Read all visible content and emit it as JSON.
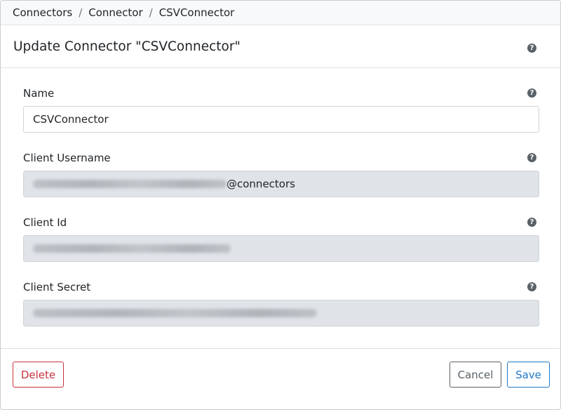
{
  "breadcrumb": {
    "items": [
      "Connectors",
      "Connector",
      "CSVConnector"
    ],
    "separator": "/"
  },
  "header": {
    "title": "Update Connector \"CSVConnector\"",
    "help_icon": "question-circle-icon"
  },
  "form": {
    "name": {
      "label": "Name",
      "value": "CSVConnector"
    },
    "client_username": {
      "label": "Client Username",
      "value_suffix": "@connectors",
      "value_redacted": true
    },
    "client_id": {
      "label": "Client Id",
      "value_redacted": true
    },
    "client_secret": {
      "label": "Client Secret",
      "value_redacted": true
    },
    "help_glyph": "?"
  },
  "footer": {
    "delete_label": "Delete",
    "cancel_label": "Cancel",
    "save_label": "Save"
  },
  "colors": {
    "danger": "#c8323e",
    "primary": "#1f78c8",
    "secondary": "#5a6268",
    "readonly_bg": "#e0e3e7"
  }
}
